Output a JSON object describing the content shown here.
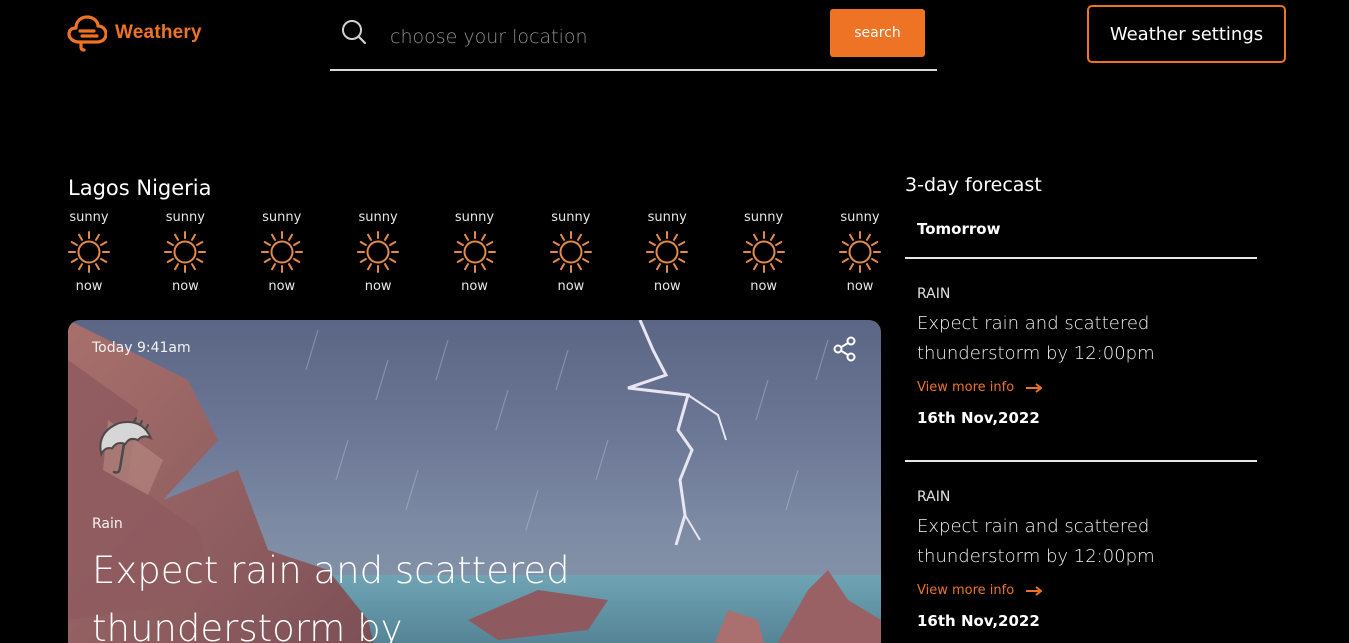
{
  "brand": {
    "name": "Weathery",
    "accent": "#ee7324",
    "logo_icon": "cloud-logo-icon"
  },
  "search": {
    "placeholder": "choose your location",
    "value": "",
    "button_label": "search",
    "icon": "search-icon"
  },
  "settings": {
    "label": "Weather settings"
  },
  "location": "Lagos Nigeria",
  "hourly": [
    {
      "condition": "sunny",
      "time": "now",
      "icon": "sun-icon"
    },
    {
      "condition": "sunny",
      "time": "now",
      "icon": "sun-icon"
    },
    {
      "condition": "sunny",
      "time": "now",
      "icon": "sun-icon"
    },
    {
      "condition": "sunny",
      "time": "now",
      "icon": "sun-icon"
    },
    {
      "condition": "sunny",
      "time": "now",
      "icon": "sun-icon"
    },
    {
      "condition": "sunny",
      "time": "now",
      "icon": "sun-icon"
    },
    {
      "condition": "sunny",
      "time": "now",
      "icon": "sun-icon"
    },
    {
      "condition": "sunny",
      "time": "now",
      "icon": "sun-icon"
    },
    {
      "condition": "sunny",
      "time": "now",
      "icon": "sun-icon"
    }
  ],
  "hero": {
    "date": "Today 9:41am",
    "type": "Rain",
    "title": "Expect rain and scattered thunderstorm by",
    "icon": "umbrella-rain-icon",
    "share_icon": "share-icon"
  },
  "forecast": {
    "title": "3-day forecast",
    "tab": "Tomorrow",
    "items": [
      {
        "type": "RAIN",
        "desc_line1": "Expect rain and scattered",
        "desc_line2": "thunderstorm by 12:00pm",
        "link": "View more info",
        "date": "16th Nov,2022"
      },
      {
        "type": "RAIN",
        "desc_line1": "Expect rain and scattered",
        "desc_line2": "thunderstorm by 12:00pm",
        "link": "View more info",
        "date": "16th Nov,2022"
      }
    ]
  }
}
